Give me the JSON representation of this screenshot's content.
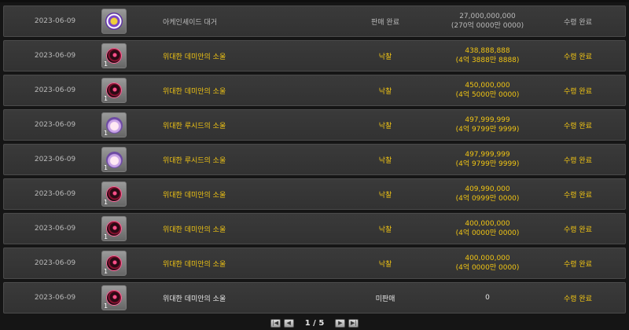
{
  "rows": [
    {
      "date": "2023-06-09",
      "item": "아케인셰이드 대거",
      "status": "판매 완료",
      "price": "27,000,000,000",
      "price_kr": "(270억 0000만 0000)",
      "receive": "수령 완료",
      "icon": "arcane-dagger-icon",
      "count": ""
    },
    {
      "date": "2023-06-09",
      "item": "위대한 데미안의 소울",
      "status": "낙찰",
      "price": "438,888,888",
      "price_kr": "(4억 3888만 8888)",
      "receive": "수령 완료",
      "icon": "demian-soul-icon",
      "count": "1"
    },
    {
      "date": "2023-06-09",
      "item": "위대한 데미안의 소울",
      "status": "낙찰",
      "price": "450,000,000",
      "price_kr": "(4억 5000만 0000)",
      "receive": "수령 완료",
      "icon": "demian-soul-icon",
      "count": "1"
    },
    {
      "date": "2023-06-09",
      "item": "위대한 루시드의 소울",
      "status": "낙찰",
      "price": "497,999,999",
      "price_kr": "(4억 9799만 9999)",
      "receive": "수령 완료",
      "icon": "lucid-soul-icon",
      "count": "1"
    },
    {
      "date": "2023-06-09",
      "item": "위대한 루시드의 소울",
      "status": "낙찰",
      "price": "497,999,999",
      "price_kr": "(4억 9799만 9999)",
      "receive": "수령 완료",
      "icon": "lucid-soul-icon",
      "count": "1"
    },
    {
      "date": "2023-06-09",
      "item": "위대한 데미안의 소울",
      "status": "낙찰",
      "price": "409,990,000",
      "price_kr": "(4억 0999만 0000)",
      "receive": "수령 완료",
      "icon": "demian-soul-icon",
      "count": "1"
    },
    {
      "date": "2023-06-09",
      "item": "위대한 데미안의 소울",
      "status": "낙찰",
      "price": "400,000,000",
      "price_kr": "(4억 0000만 0000)",
      "receive": "수령 완료",
      "icon": "demian-soul-icon",
      "count": "1"
    },
    {
      "date": "2023-06-09",
      "item": "위대한 데미안의 소울",
      "status": "낙찰",
      "price": "400,000,000",
      "price_kr": "(4억 0000만 0000)",
      "receive": "수령 완료",
      "icon": "demian-soul-icon",
      "count": "1"
    },
    {
      "date": "2023-06-09",
      "item": "위대한 데미안의 소울",
      "status": "미판매",
      "price": "0",
      "price_kr": "",
      "receive": "수령 완료",
      "icon": "demian-soul-icon",
      "count": "1"
    }
  ],
  "pagination": {
    "current": "1",
    "separator": "/",
    "total": "5",
    "first_icon": "first-page-icon",
    "prev_icon": "prev-page-icon",
    "next_icon": "next-page-icon",
    "last_icon": "last-page-icon"
  },
  "colors": {
    "highlight": "#f0c414",
    "normal": "#b9b9b9",
    "row_bg": "#363636"
  }
}
